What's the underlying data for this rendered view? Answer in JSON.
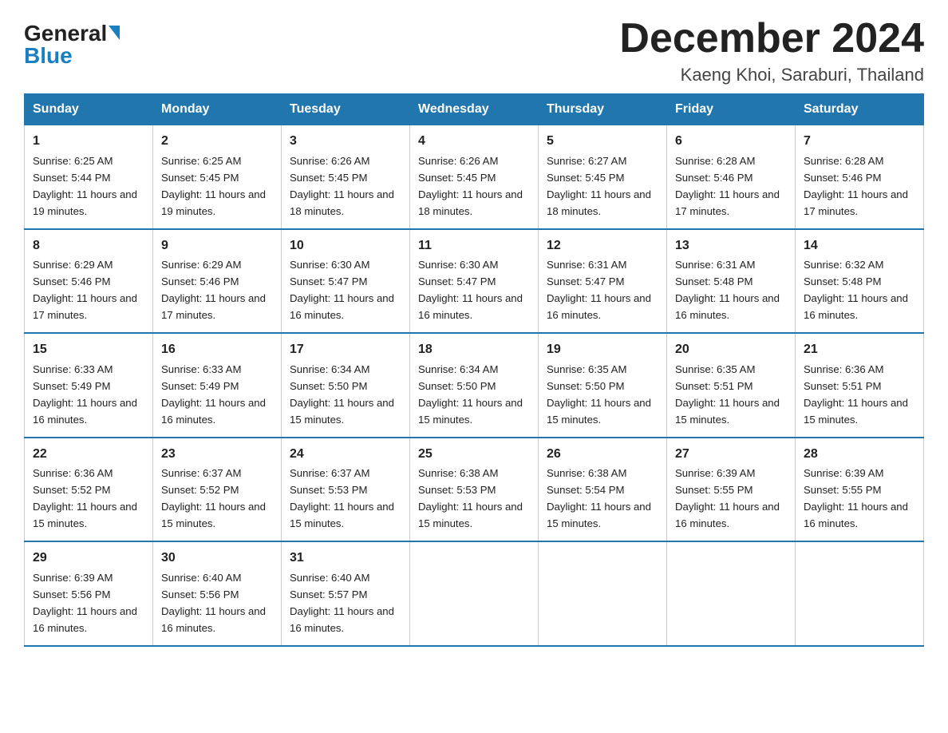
{
  "logo": {
    "general": "General",
    "blue": "Blue"
  },
  "title": "December 2024",
  "subtitle": "Kaeng Khoi, Saraburi, Thailand",
  "header_days": [
    "Sunday",
    "Monday",
    "Tuesday",
    "Wednesday",
    "Thursday",
    "Friday",
    "Saturday"
  ],
  "weeks": [
    [
      {
        "day": "1",
        "sunrise": "6:25 AM",
        "sunset": "5:44 PM",
        "daylight": "11 hours and 19 minutes."
      },
      {
        "day": "2",
        "sunrise": "6:25 AM",
        "sunset": "5:45 PM",
        "daylight": "11 hours and 19 minutes."
      },
      {
        "day": "3",
        "sunrise": "6:26 AM",
        "sunset": "5:45 PM",
        "daylight": "11 hours and 18 minutes."
      },
      {
        "day": "4",
        "sunrise": "6:26 AM",
        "sunset": "5:45 PM",
        "daylight": "11 hours and 18 minutes."
      },
      {
        "day": "5",
        "sunrise": "6:27 AM",
        "sunset": "5:45 PM",
        "daylight": "11 hours and 18 minutes."
      },
      {
        "day": "6",
        "sunrise": "6:28 AM",
        "sunset": "5:46 PM",
        "daylight": "11 hours and 17 minutes."
      },
      {
        "day": "7",
        "sunrise": "6:28 AM",
        "sunset": "5:46 PM",
        "daylight": "11 hours and 17 minutes."
      }
    ],
    [
      {
        "day": "8",
        "sunrise": "6:29 AM",
        "sunset": "5:46 PM",
        "daylight": "11 hours and 17 minutes."
      },
      {
        "day": "9",
        "sunrise": "6:29 AM",
        "sunset": "5:46 PM",
        "daylight": "11 hours and 17 minutes."
      },
      {
        "day": "10",
        "sunrise": "6:30 AM",
        "sunset": "5:47 PM",
        "daylight": "11 hours and 16 minutes."
      },
      {
        "day": "11",
        "sunrise": "6:30 AM",
        "sunset": "5:47 PM",
        "daylight": "11 hours and 16 minutes."
      },
      {
        "day": "12",
        "sunrise": "6:31 AM",
        "sunset": "5:47 PM",
        "daylight": "11 hours and 16 minutes."
      },
      {
        "day": "13",
        "sunrise": "6:31 AM",
        "sunset": "5:48 PM",
        "daylight": "11 hours and 16 minutes."
      },
      {
        "day": "14",
        "sunrise": "6:32 AM",
        "sunset": "5:48 PM",
        "daylight": "11 hours and 16 minutes."
      }
    ],
    [
      {
        "day": "15",
        "sunrise": "6:33 AM",
        "sunset": "5:49 PM",
        "daylight": "11 hours and 16 minutes."
      },
      {
        "day": "16",
        "sunrise": "6:33 AM",
        "sunset": "5:49 PM",
        "daylight": "11 hours and 16 minutes."
      },
      {
        "day": "17",
        "sunrise": "6:34 AM",
        "sunset": "5:50 PM",
        "daylight": "11 hours and 15 minutes."
      },
      {
        "day": "18",
        "sunrise": "6:34 AM",
        "sunset": "5:50 PM",
        "daylight": "11 hours and 15 minutes."
      },
      {
        "day": "19",
        "sunrise": "6:35 AM",
        "sunset": "5:50 PM",
        "daylight": "11 hours and 15 minutes."
      },
      {
        "day": "20",
        "sunrise": "6:35 AM",
        "sunset": "5:51 PM",
        "daylight": "11 hours and 15 minutes."
      },
      {
        "day": "21",
        "sunrise": "6:36 AM",
        "sunset": "5:51 PM",
        "daylight": "11 hours and 15 minutes."
      }
    ],
    [
      {
        "day": "22",
        "sunrise": "6:36 AM",
        "sunset": "5:52 PM",
        "daylight": "11 hours and 15 minutes."
      },
      {
        "day": "23",
        "sunrise": "6:37 AM",
        "sunset": "5:52 PM",
        "daylight": "11 hours and 15 minutes."
      },
      {
        "day": "24",
        "sunrise": "6:37 AM",
        "sunset": "5:53 PM",
        "daylight": "11 hours and 15 minutes."
      },
      {
        "day": "25",
        "sunrise": "6:38 AM",
        "sunset": "5:53 PM",
        "daylight": "11 hours and 15 minutes."
      },
      {
        "day": "26",
        "sunrise": "6:38 AM",
        "sunset": "5:54 PM",
        "daylight": "11 hours and 15 minutes."
      },
      {
        "day": "27",
        "sunrise": "6:39 AM",
        "sunset": "5:55 PM",
        "daylight": "11 hours and 16 minutes."
      },
      {
        "day": "28",
        "sunrise": "6:39 AM",
        "sunset": "5:55 PM",
        "daylight": "11 hours and 16 minutes."
      }
    ],
    [
      {
        "day": "29",
        "sunrise": "6:39 AM",
        "sunset": "5:56 PM",
        "daylight": "11 hours and 16 minutes."
      },
      {
        "day": "30",
        "sunrise": "6:40 AM",
        "sunset": "5:56 PM",
        "daylight": "11 hours and 16 minutes."
      },
      {
        "day": "31",
        "sunrise": "6:40 AM",
        "sunset": "5:57 PM",
        "daylight": "11 hours and 16 minutes."
      },
      null,
      null,
      null,
      null
    ]
  ]
}
